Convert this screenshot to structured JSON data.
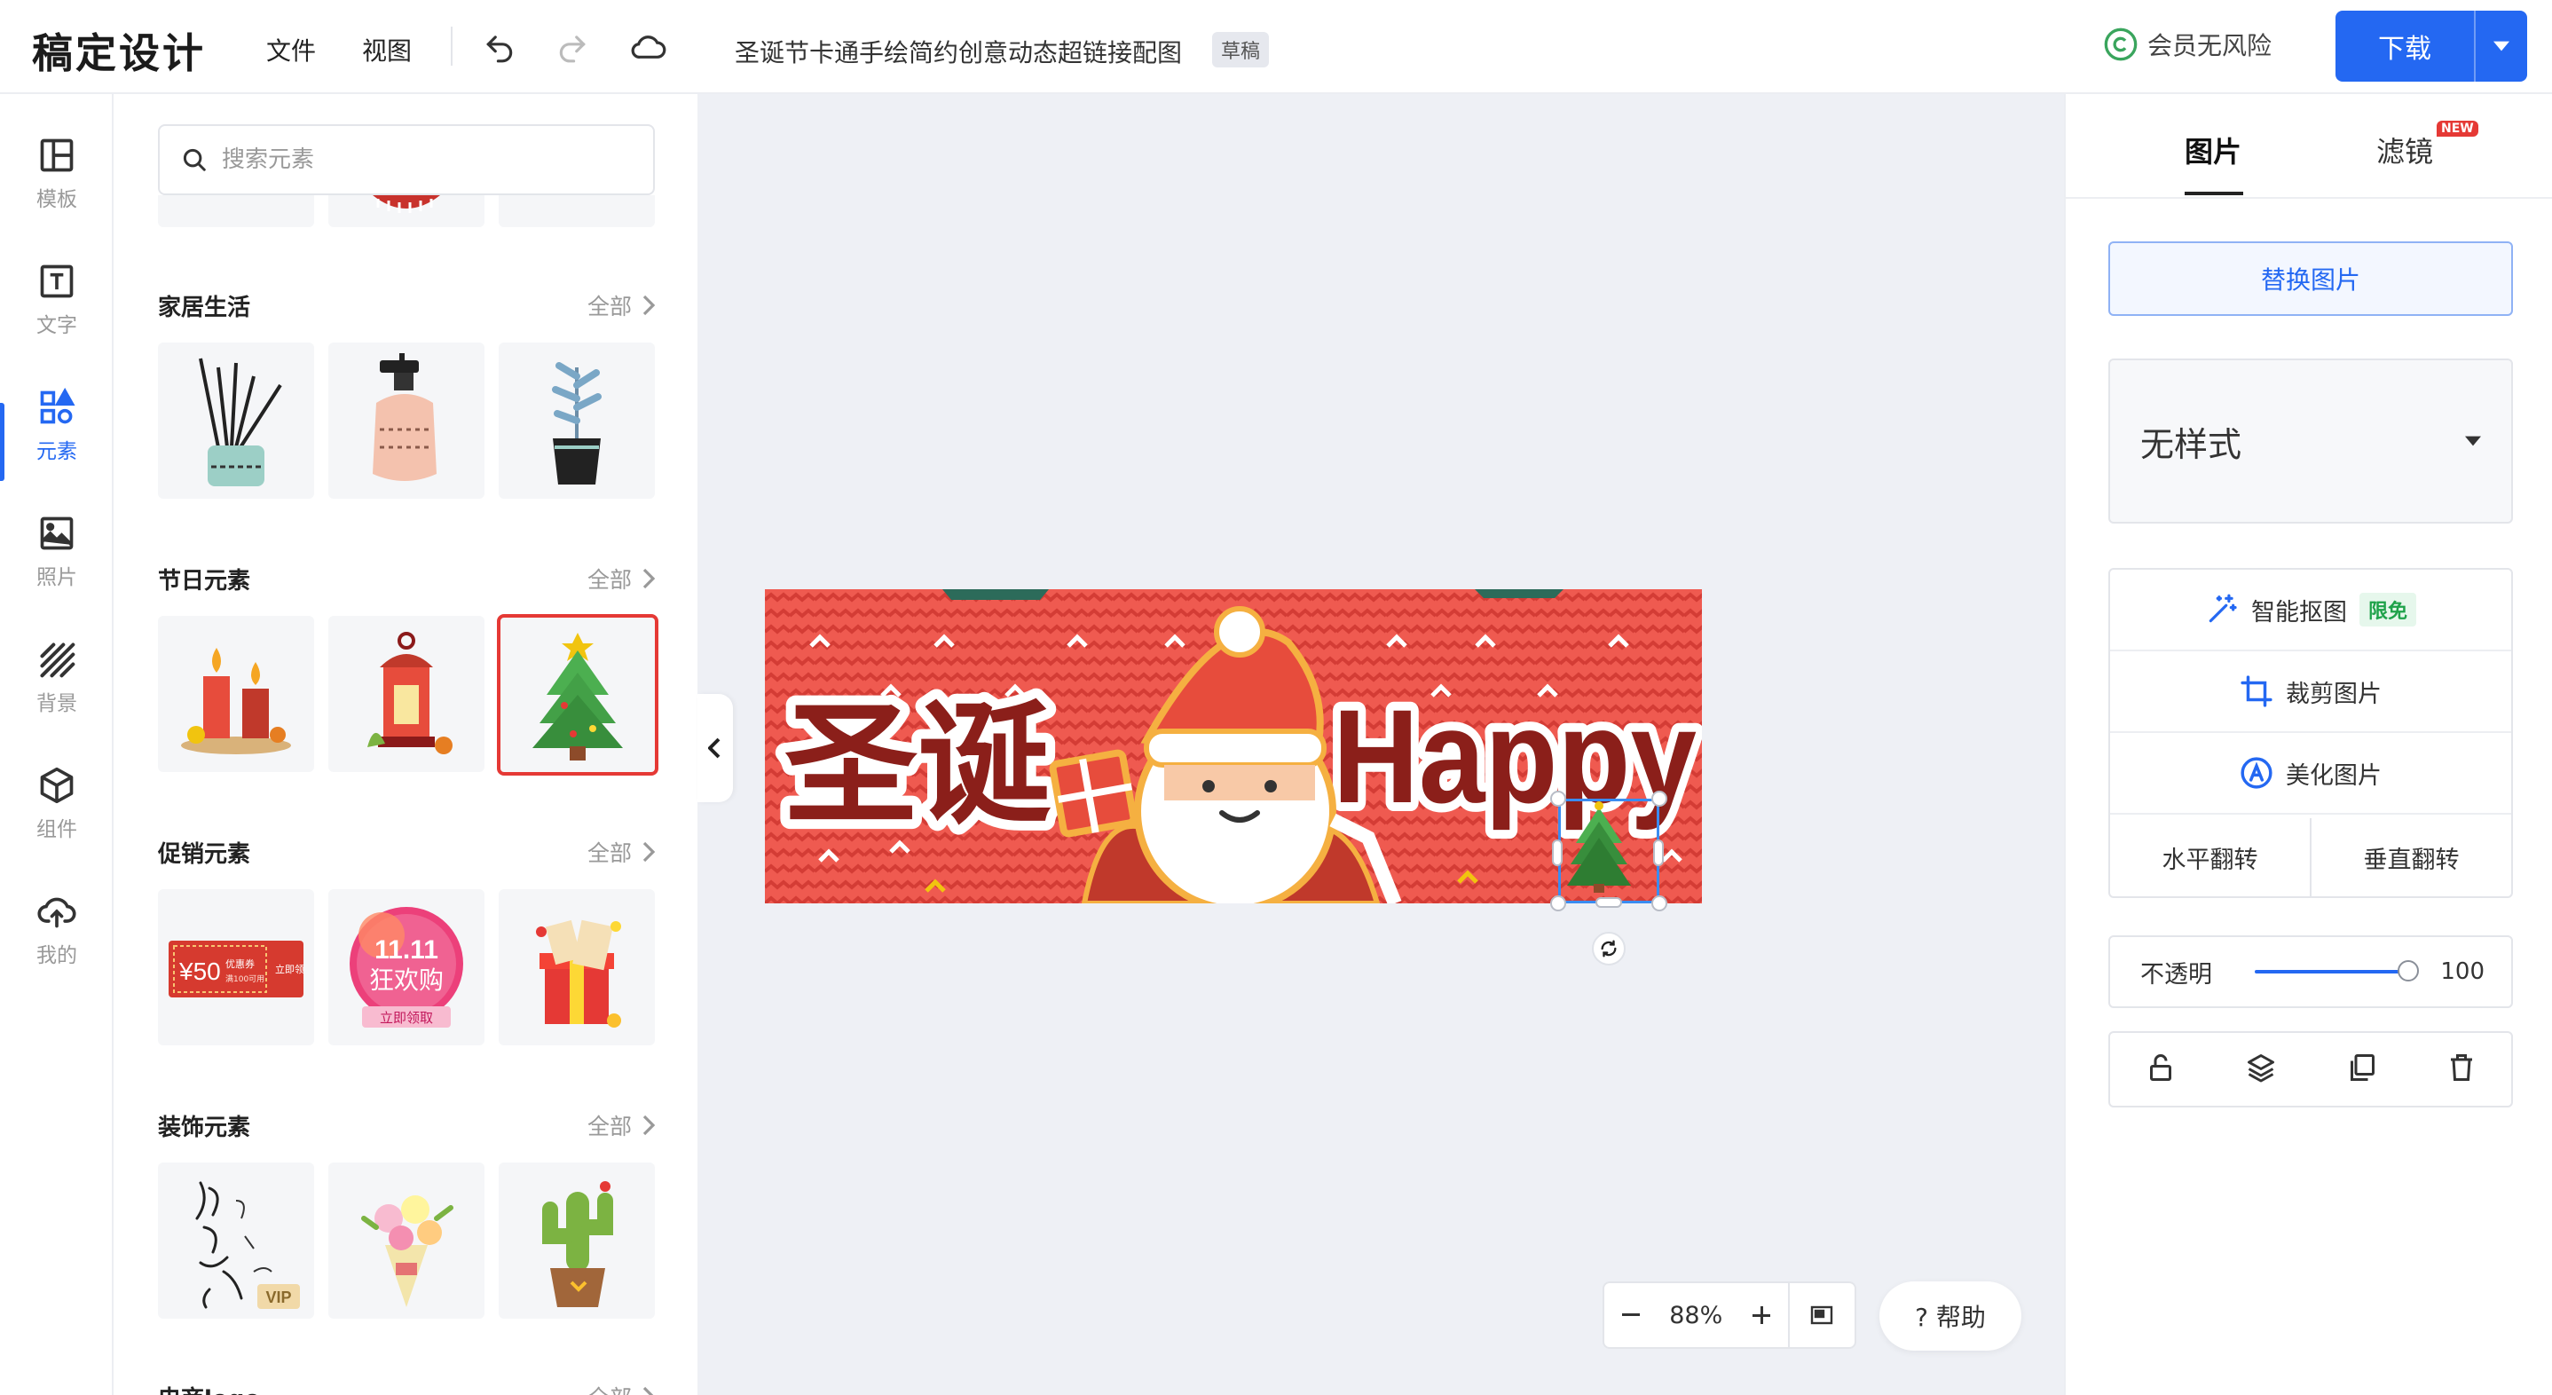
{
  "header": {
    "logo": "稿定设计",
    "menu": [
      "文件",
      "视图"
    ],
    "doc_title": "圣诞节卡通手绘简约创意动态超链接配图",
    "draft_badge": "草稿",
    "member_text": "会员无风险",
    "download_label": "下载",
    "accent": "#2468f2"
  },
  "rail": {
    "items": [
      {
        "label": "模板",
        "icon": "template-icon"
      },
      {
        "label": "文字",
        "icon": "text-icon"
      },
      {
        "label": "元素",
        "icon": "elements-icon"
      },
      {
        "label": "照片",
        "icon": "photo-icon"
      },
      {
        "label": "背景",
        "icon": "background-icon"
      },
      {
        "label": "组件",
        "icon": "component-icon"
      },
      {
        "label": "我的",
        "icon": "upload-icon"
      }
    ],
    "active_index": 2
  },
  "panel": {
    "search_placeholder": "搜索元素",
    "all_label": "全部",
    "sections": [
      {
        "title": "家居生活"
      },
      {
        "title": "节日元素"
      },
      {
        "title": "促销元素",
        "coupon_price": "¥50",
        "coupon_line1": "优惠券",
        "coupon_line2": "满100可用",
        "coupon_side": "立即领",
        "promo_top": "11.11",
        "promo_mid": "狂欢购",
        "promo_bottom": "立即领取"
      },
      {
        "title": "装饰元素",
        "vip_badge": "VIP"
      },
      {
        "title": "电商logo"
      }
    ]
  },
  "canvas": {
    "banner_text_left": "圣诞",
    "banner_text_right": "Happy",
    "banner_bg": "#e94b43",
    "zoom": "88%",
    "help_label": "? 帮助"
  },
  "right_panel": {
    "tabs": [
      "图片",
      "滤镜"
    ],
    "new_badge": "NEW",
    "replace_label": "替换图片",
    "style_value": "无样式",
    "tools": [
      {
        "label": "智能抠图",
        "badge": "限免",
        "icon": "magic-wand-icon"
      },
      {
        "label": "裁剪图片",
        "icon": "crop-icon"
      },
      {
        "label": "美化图片",
        "icon": "beautify-icon"
      }
    ],
    "flip_h": "水平翻转",
    "flip_v": "垂直翻转",
    "opacity_label": "不透明",
    "opacity_value": "100"
  }
}
